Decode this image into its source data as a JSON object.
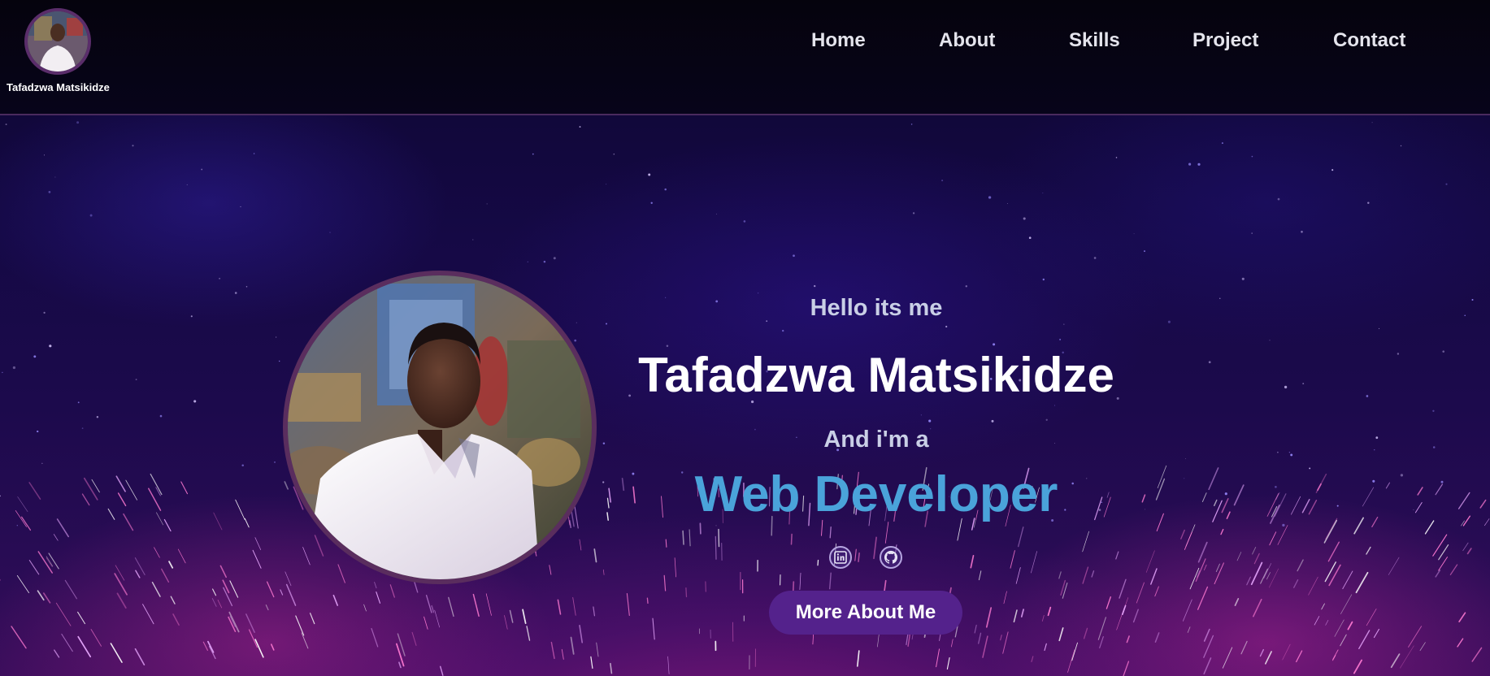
{
  "brand": {
    "name": "Tafadzwa Matsikidze",
    "avatar_icon": "profile-photo"
  },
  "nav": {
    "items": [
      {
        "label": "Home"
      },
      {
        "label": "About"
      },
      {
        "label": "Skills"
      },
      {
        "label": "Project"
      },
      {
        "label": "Contact"
      }
    ]
  },
  "hero": {
    "greeting": "Hello its me",
    "name": "Tafadzwa Matsikidze",
    "role_intro": "And i'm a",
    "role": "Web Developer",
    "photo_icon": "profile-photo",
    "social": [
      {
        "icon": "linkedin-icon"
      },
      {
        "icon": "github-icon"
      }
    ],
    "cta_label": "More About Me"
  },
  "colors": {
    "accent": "#54228c",
    "role_text": "#4aa3da",
    "nav_text": "#e4e4ec",
    "border": "#5a2d5e"
  }
}
